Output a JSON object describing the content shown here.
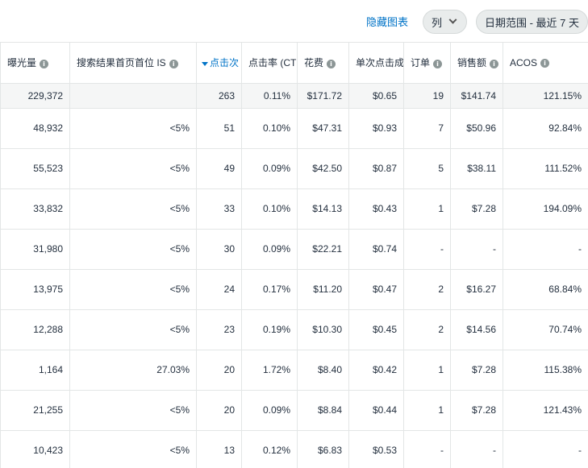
{
  "toolbar": {
    "hide_chart": "隐藏图表",
    "columns_button": "列",
    "date_range_button": "日期范围 - 最近 7 天"
  },
  "columns": [
    {
      "label": "曝光量",
      "info": true
    },
    {
      "label": "搜索结果首页首位 IS",
      "info": true
    },
    {
      "label": "点击次",
      "sorted": "desc"
    },
    {
      "label": "点击率 (CTR",
      "info": false
    },
    {
      "label": "花费",
      "info": true
    },
    {
      "label": "单次点击成",
      "info": false
    },
    {
      "label": "订单",
      "info": true
    },
    {
      "label": "销售额",
      "info": true
    },
    {
      "label": "ACOS",
      "info": true
    }
  ],
  "total_row": [
    "229,372",
    "",
    "263",
    "0.11%",
    "$171.72",
    "$0.65",
    "19",
    "$141.74",
    "121.15%"
  ],
  "rows": [
    [
      "48,932",
      "<5%",
      "51",
      "0.10%",
      "$47.31",
      "$0.93",
      "7",
      "$50.96",
      "92.84%"
    ],
    [
      "55,523",
      "<5%",
      "49",
      "0.09%",
      "$42.50",
      "$0.87",
      "5",
      "$38.11",
      "111.52%"
    ],
    [
      "33,832",
      "<5%",
      "33",
      "0.10%",
      "$14.13",
      "$0.43",
      "1",
      "$7.28",
      "194.09%"
    ],
    [
      "31,980",
      "<5%",
      "30",
      "0.09%",
      "$22.21",
      "$0.74",
      "-",
      "-",
      "-"
    ],
    [
      "13,975",
      "<5%",
      "24",
      "0.17%",
      "$11.20",
      "$0.47",
      "2",
      "$16.27",
      "68.84%"
    ],
    [
      "12,288",
      "<5%",
      "23",
      "0.19%",
      "$10.30",
      "$0.45",
      "2",
      "$14.56",
      "70.74%"
    ],
    [
      "1,164",
      "27.03%",
      "20",
      "1.72%",
      "$8.40",
      "$0.42",
      "1",
      "$7.28",
      "115.38%"
    ],
    [
      "21,255",
      "<5%",
      "20",
      "0.09%",
      "$8.84",
      "$0.44",
      "1",
      "$7.28",
      "121.43%"
    ],
    [
      "10,423",
      "<5%",
      "13",
      "0.12%",
      "$6.83",
      "$0.53",
      "-",
      "-",
      "-"
    ]
  ]
}
